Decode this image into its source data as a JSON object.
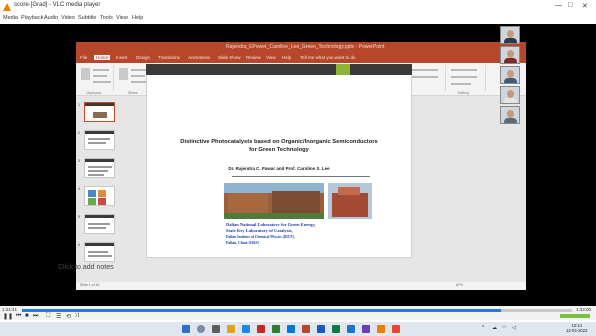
{
  "vlc": {
    "window_title": "score-[Grad] - VLC media player",
    "menu": [
      "Media",
      "Playback",
      "Audio",
      "Video",
      "Subtitle",
      "Tools",
      "View",
      "Help"
    ],
    "controls": {
      "elapsed": "1:24:41",
      "total": "1:33:00",
      "progress": 0.87,
      "volume": 1.0
    }
  },
  "powerpoint": {
    "title": "Rajendra_EPower_Caroline_Lee_Green_Technology.pptx - PowerPoint",
    "tabs": [
      "File",
      "Home",
      "Insert",
      "Design",
      "Transitions",
      "Animations",
      "Slide Show",
      "Review",
      "View",
      "Help",
      "Tell me what you want to do"
    ],
    "ribbon_groups": [
      "Clipboard",
      "Slides",
      "Font",
      "Paragraph",
      "Drawing",
      "Editing"
    ],
    "thumbnail_numbers": [
      "1",
      "2",
      "3",
      "4",
      "5",
      "6"
    ],
    "notes_placeholder": "Click to add notes",
    "status_left": "Slide 1 of 41",
    "status_zoom": "87%"
  },
  "slide": {
    "title_lines": [
      "Distinctive Photocatalysts based on Organic/Inorganic Semiconductors",
      "for Green Technology"
    ],
    "authors": "Dr. Rajendra C. Pawar and Prof. Caroline S. Lee",
    "affiliation_lines": [
      "Dalian National Laboratory for Green Energy,",
      "State Key Laboratory of Catalysis,",
      "Dalian Institute of Chemical Physics (DICP),",
      "Dalian, China 116023"
    ]
  },
  "taskbar": {
    "time": "10:14",
    "date": "12-04-2022"
  },
  "colors": {
    "ppt_accent": "#b7472a",
    "slide_bar": "#3a3a3a",
    "slide_accent": "#8fb43a",
    "affiliation_text": "#1f3fa8",
    "seek_fill": "#2b7bd6"
  }
}
